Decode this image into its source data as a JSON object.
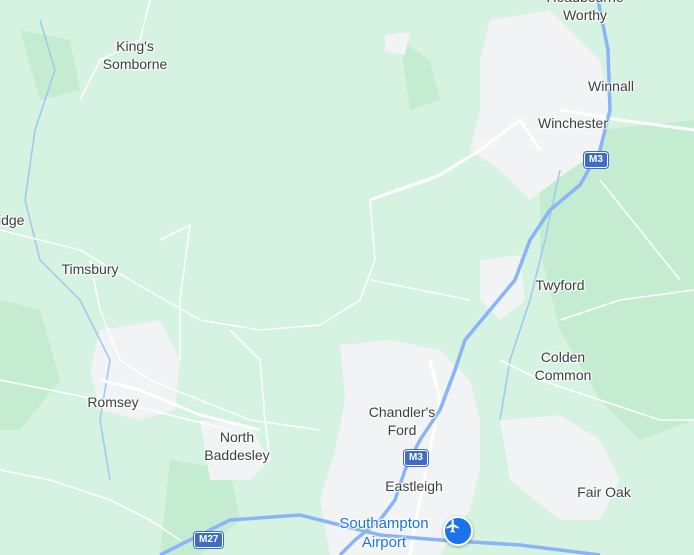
{
  "map": {
    "colors": {
      "land": "#d6f2e0",
      "woodland": "#bfe8cc",
      "urban": "#f1f3f4",
      "road": "#ffffff",
      "motorway": "#8ab4f8",
      "shield": "#3f6cc4",
      "label": "#3c4043",
      "airport_accent": "#1a73e8"
    },
    "places": [
      {
        "id": "headbourne-worthy",
        "text": "Headbourne\nWorthy"
      },
      {
        "id": "kings-somborne",
        "text": "King's\nSomborne"
      },
      {
        "id": "winnall",
        "text": "Winnall"
      },
      {
        "id": "winchester",
        "text": "Winchester"
      },
      {
        "id": "idge",
        "text": "idge"
      },
      {
        "id": "timsbury",
        "text": "Timsbury"
      },
      {
        "id": "twyford",
        "text": "Twyford"
      },
      {
        "id": "colden-common",
        "text": "Colden\nCommon"
      },
      {
        "id": "romsey",
        "text": "Romsey"
      },
      {
        "id": "chandlers-ford",
        "text": "Chandler's\nFord"
      },
      {
        "id": "north-baddesley",
        "text": "North\nBaddesley"
      },
      {
        "id": "eastleigh",
        "text": "Eastleigh"
      },
      {
        "id": "fair-oak",
        "text": "Fair Oak"
      }
    ],
    "airport": {
      "text": "Southampton\nAirport",
      "icon": "airplane-icon"
    },
    "shields": [
      {
        "id": "m3-north",
        "text": "M3"
      },
      {
        "id": "m3-south",
        "text": "M3"
      },
      {
        "id": "m27",
        "text": "M27"
      }
    ]
  }
}
